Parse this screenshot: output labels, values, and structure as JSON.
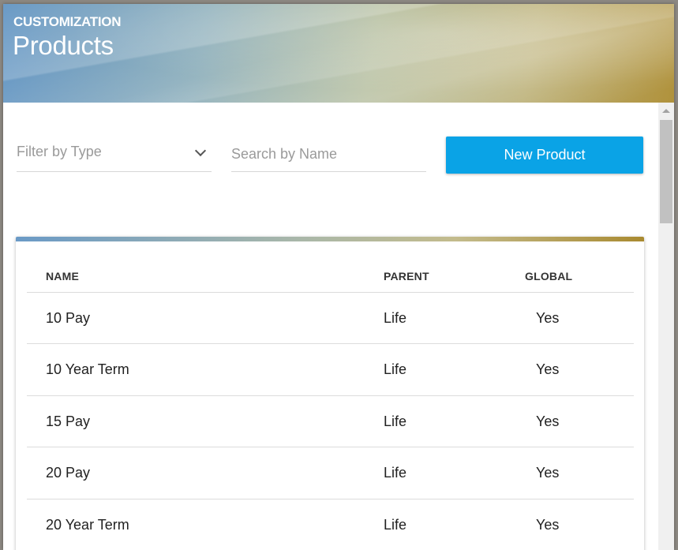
{
  "header": {
    "eyebrow": "CUSTOMIZATION",
    "title": "Products"
  },
  "filters": {
    "type_placeholder": "Filter by Type",
    "search_placeholder": "Search by Name"
  },
  "actions": {
    "new_product_label": "New Product"
  },
  "table": {
    "columns": [
      "NAME",
      "PARENT",
      "GLOBAL"
    ],
    "rows": [
      {
        "name": "10 Pay",
        "parent": "Life",
        "global": "Yes"
      },
      {
        "name": "10 Year Term",
        "parent": "Life",
        "global": "Yes"
      },
      {
        "name": "15 Pay",
        "parent": "Life",
        "global": "Yes"
      },
      {
        "name": "20 Pay",
        "parent": "Life",
        "global": "Yes"
      },
      {
        "name": "20 Year Term",
        "parent": "Life",
        "global": "Yes"
      }
    ]
  },
  "colors": {
    "accent": "#0aa3e6"
  }
}
